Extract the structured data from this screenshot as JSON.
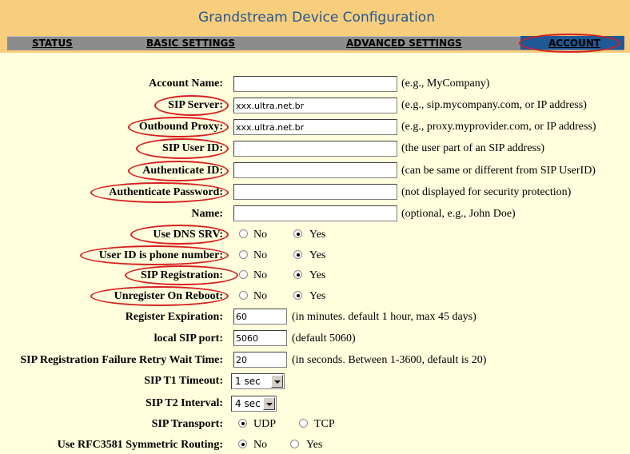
{
  "header": {
    "title": "Grandstream Device Configuration"
  },
  "nav": {
    "status": "STATUS",
    "basic": "BASIC SETTINGS",
    "advanced": "ADVANCED SETTINGS",
    "account": "ACCOUNT"
  },
  "form": {
    "account_name": {
      "label": "Account Name:",
      "value": "",
      "hint": "(e.g., MyCompany)"
    },
    "sip_server": {
      "label": "SIP Server:",
      "value": "xxx.ultra.net.br",
      "hint": "(e.g., sip.mycompany.com, or IP address)"
    },
    "outbound_proxy": {
      "label": "Outbound Proxy:",
      "value": "xxx.ultra.net.br",
      "hint": "(e.g., proxy.myprovider.com, or IP address)"
    },
    "sip_user_id": {
      "label": "SIP User ID:",
      "value": "",
      "hint": "(the user part of an SIP address)"
    },
    "authenticate_id": {
      "label": "Authenticate ID:",
      "value": "",
      "hint": "(can be same or different from SIP UserID)"
    },
    "authenticate_password": {
      "label": "Authenticate Password:",
      "value": "",
      "hint": "(not displayed for security protection)"
    },
    "name": {
      "label": "Name:",
      "value": "",
      "hint": "(optional, e.g., John Doe)"
    },
    "use_dns_srv": {
      "label": "Use DNS SRV:",
      "options": [
        "No",
        "Yes"
      ],
      "selected": "Yes"
    },
    "user_id_is_phone": {
      "label": "User ID is phone number:",
      "options": [
        "No",
        "Yes"
      ],
      "selected": "Yes"
    },
    "sip_registration": {
      "label": "SIP Registration:",
      "options": [
        "No",
        "Yes"
      ],
      "selected": "Yes"
    },
    "unregister_on_reboot": {
      "label": "Unregister On Reboot:",
      "options": [
        "No",
        "Yes"
      ],
      "selected": "Yes"
    },
    "register_expiration": {
      "label": "Register Expiration:",
      "value": "60",
      "hint": "(in minutes. default 1 hour, max 45 days)"
    },
    "local_sip_port": {
      "label": "local SIP port:",
      "value": "5060",
      "hint": "(default 5060)"
    },
    "retry_wait_time": {
      "label": "SIP Registration Failure Retry Wait Time:",
      "value": "20",
      "hint": "(in seconds. Between 1-3600, default is 20)"
    },
    "sip_t1_timeout": {
      "label": "SIP T1 Timeout:",
      "value": "1 sec"
    },
    "sip_t2_interval": {
      "label": "SIP T2 Interval:",
      "value": "4 sec"
    },
    "sip_transport": {
      "label": "SIP Transport:",
      "options": [
        "UDP",
        "TCP"
      ],
      "selected": "UDP"
    },
    "rfc3581": {
      "label": "Use RFC3581 Symmetric Routing:",
      "options": [
        "No",
        "Yes"
      ],
      "selected": "No"
    }
  },
  "colors": {
    "header_bg": "#F8CD7C",
    "title_text": "#1F5896",
    "nav_bg": "#8C8C8C",
    "nav_active_bg": "#1F5896",
    "page_bg": "#FFFFDD",
    "annotation_ring": "#D61F1F"
  }
}
